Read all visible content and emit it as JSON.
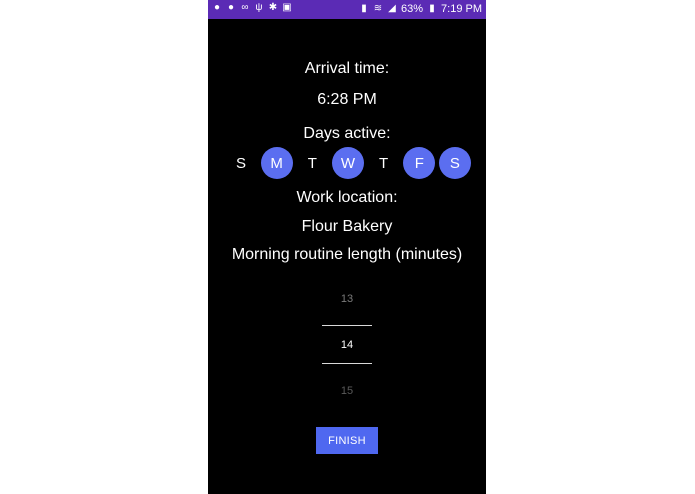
{
  "status_bar": {
    "battery": "63%",
    "time": "7:19 PM",
    "icons_left": [
      "messenger-icon",
      "messenger-icon",
      "voicemail-icon",
      "usb-icon",
      "bug-icon",
      "image-icon"
    ],
    "icons_right": [
      "nfc-icon",
      "wifi-icon",
      "signal-icon",
      "battery-icon"
    ]
  },
  "arrival": {
    "label": "Arrival time:",
    "value": "6:28 PM"
  },
  "days": {
    "label": "Days active:",
    "items": [
      {
        "letter": "S",
        "active": false
      },
      {
        "letter": "M",
        "active": true
      },
      {
        "letter": "T",
        "active": false
      },
      {
        "letter": "W",
        "active": true
      },
      {
        "letter": "T",
        "active": false
      },
      {
        "letter": "F",
        "active": true
      },
      {
        "letter": "S",
        "active": true
      }
    ]
  },
  "work_location": {
    "label": "Work location:",
    "value": "Flour Bakery"
  },
  "routine": {
    "label": "Morning routine length (minutes)",
    "prev": "13",
    "current": "14",
    "next": "15"
  },
  "finish_label": "FINISH",
  "colors": {
    "status_bar": "#5b2bb5",
    "accent": "#5b6ef0",
    "background": "#000000"
  }
}
